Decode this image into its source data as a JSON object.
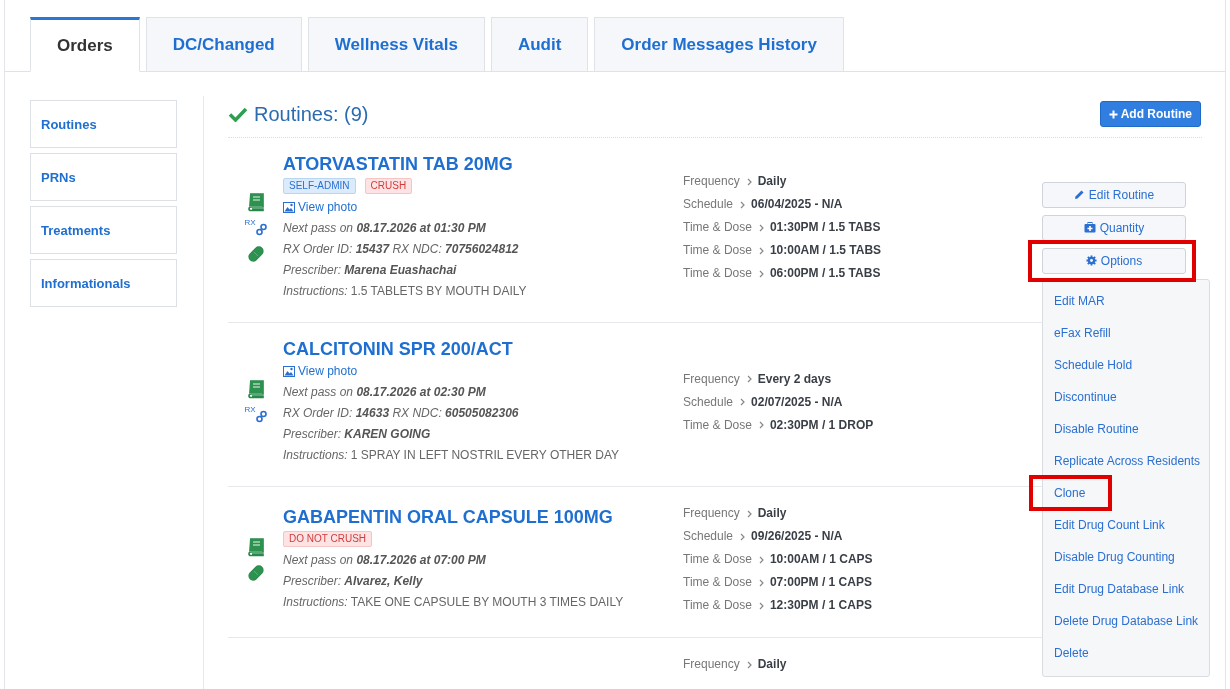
{
  "tabs": [
    {
      "label": "Orders",
      "selected": true
    },
    {
      "label": "DC/Changed",
      "selected": false
    },
    {
      "label": "Wellness Vitals",
      "selected": false
    },
    {
      "label": "Audit",
      "selected": false
    },
    {
      "label": "Order Messages History",
      "selected": false
    }
  ],
  "sidebar": {
    "items": [
      {
        "label": "Routines"
      },
      {
        "label": "PRNs"
      },
      {
        "label": "Treatments"
      },
      {
        "label": "Informationals"
      }
    ]
  },
  "section": {
    "title": "Routines: (9)",
    "add_button": "Add Routine"
  },
  "rows": [
    {
      "title": "ATORVASTATIN TAB 20MG",
      "badges": [
        {
          "text": "SELF-ADMIN",
          "kind": "info"
        },
        {
          "text": "CRUSH",
          "kind": "warning"
        }
      ],
      "icons": [
        {
          "kind": "book"
        },
        {
          "kind": "rx-link",
          "text": "RX"
        },
        {
          "kind": "pill"
        }
      ],
      "view_photo": "View photo",
      "lines": [
        "Next pass on **08.17.2026 at 01:30 PM**",
        "RX Order ID: **15437** RX NDC: **70756024812**",
        "Prescriber: **Marena Euashachai**"
      ],
      "instructions_label": "Instructions:",
      "instructions": "1.5 TABLETS BY MOUTH DAILY",
      "details": [
        {
          "label": "Frequency",
          "value": "Daily"
        },
        {
          "label": "Schedule",
          "value": "06/04/2025 - N/A"
        },
        {
          "label": "Time & Dose",
          "value": "01:30PM / 1.5 TABS"
        },
        {
          "label": "Time & Dose",
          "value": "10:00AM / 1.5 TABS"
        },
        {
          "label": "Time & Dose",
          "value": "06:00PM / 1.5 TABS"
        }
      ],
      "actions": [
        {
          "label": "Edit Routine",
          "kind": "pencil",
          "highlighted": false
        },
        {
          "label": "Quantity",
          "kind": "kit",
          "highlighted": false
        },
        {
          "label": "Options",
          "kind": "gear",
          "highlighted": true
        }
      ]
    },
    {
      "title": "CALCITONIN SPR 200/ACT",
      "icons": [
        {
          "kind": "book"
        },
        {
          "kind": "rx-link",
          "text": "RX"
        }
      ],
      "view_photo": "View photo",
      "lines": [
        "Next pass on **08.17.2026 at 02:30 PM**",
        "RX Order ID: **14633** RX NDC: **60505082306**",
        "Prescriber: **KAREN GOING**"
      ],
      "instructions_label": "Instructions:",
      "instructions": "1 SPRAY IN LEFT NOSTRIL EVERY OTHER DAY",
      "details": [
        {
          "label": "Frequency",
          "value": "Every 2 days"
        },
        {
          "label": "Schedule",
          "value": "02/07/2025 - N/A"
        },
        {
          "label": "Time & Dose",
          "value": "02:30PM / 1 DROP"
        }
      ]
    },
    {
      "title": "GABAPENTIN ORAL CAPSULE 100MG",
      "badges": [
        {
          "text": "DO NOT CRUSH",
          "kind": "warning"
        }
      ],
      "icons": [
        {
          "kind": "book"
        },
        {
          "kind": "pill"
        }
      ],
      "lines": [
        "Next pass on **08.17.2026 at 07:00 PM**",
        "Prescriber: **Alvarez, Kelly**"
      ],
      "instructions_label": "Instructions:",
      "instructions": "TAKE ONE CAPSULE BY MOUTH 3 TIMES DAILY",
      "details": [
        {
          "label": "Frequency",
          "value": "Daily"
        },
        {
          "label": "Schedule",
          "value": "09/26/2025 - N/A"
        },
        {
          "label": "Time & Dose",
          "value": "10:00AM / 1 CAPS"
        },
        {
          "label": "Time & Dose",
          "value": "07:00PM / 1 CAPS"
        },
        {
          "label": "Time & Dose",
          "value": "12:30PM / 1 CAPS"
        }
      ]
    },
    {
      "details": [
        {
          "label": "Frequency",
          "value": "Daily"
        }
      ]
    }
  ],
  "options_menu": {
    "items": [
      {
        "label": "Edit MAR",
        "highlighted": false
      },
      {
        "label": "eFax Refill",
        "highlighted": false
      },
      {
        "label": "Schedule Hold",
        "highlighted": false
      },
      {
        "label": "Discontinue",
        "highlighted": false
      },
      {
        "label": "Disable Routine",
        "highlighted": false
      },
      {
        "label": "Replicate Across Residents",
        "highlighted": false
      },
      {
        "label": "Clone",
        "highlighted": true
      },
      {
        "label": "Edit Drug Count Link",
        "highlighted": false
      },
      {
        "label": "Disable Drug Counting",
        "highlighted": false
      },
      {
        "label": "Edit Drug Database Link",
        "highlighted": false
      },
      {
        "label": "Delete Drug Database Link",
        "highlighted": false
      },
      {
        "label": "Delete",
        "highlighted": false
      }
    ]
  }
}
